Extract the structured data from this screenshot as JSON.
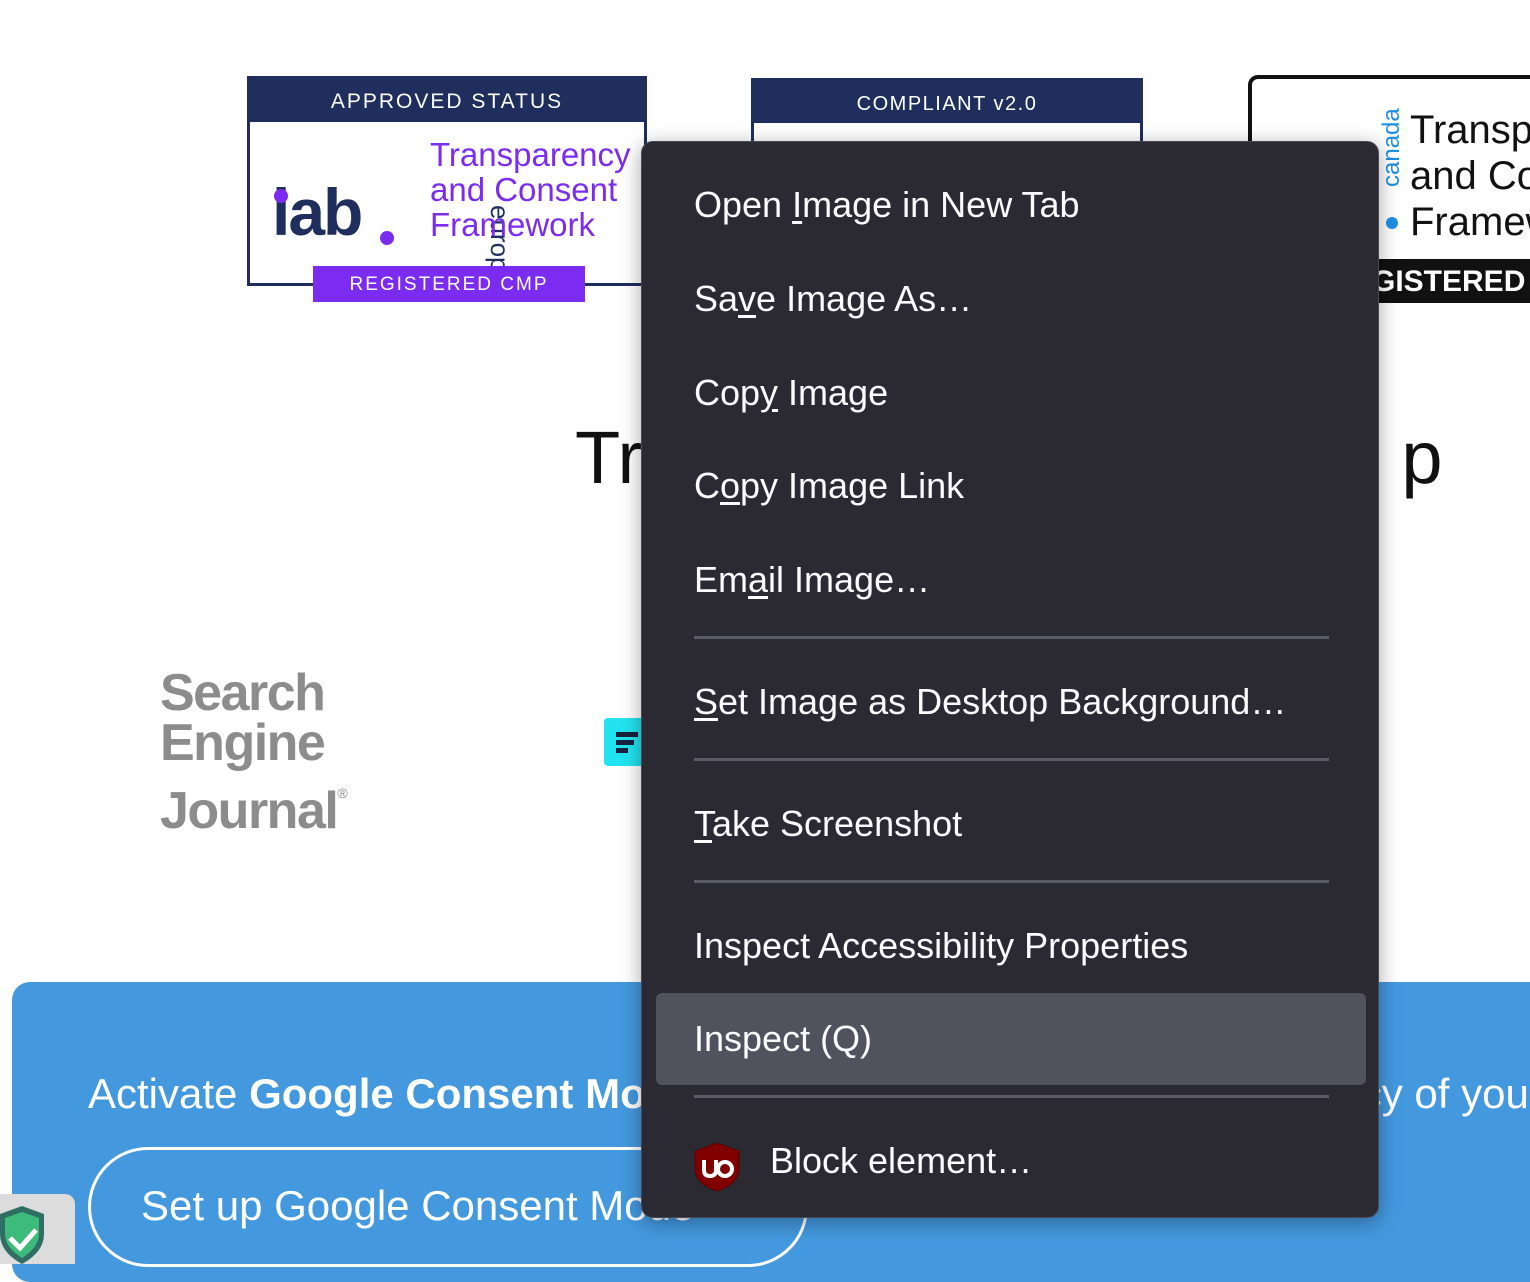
{
  "badges": {
    "iab_europe": {
      "header": "APPROVED STATUS",
      "logo": "iab",
      "region": "europe",
      "title_lines": [
        "Transparency",
        "and Consent",
        "Framework"
      ],
      "footer": "REGISTERED CMP"
    },
    "compliant": {
      "header": "COMPLIANT v2.0"
    },
    "iab_canada": {
      "region": "canada",
      "title_lines": [
        "Transpa",
        "and Cor",
        "Framew"
      ],
      "footer": "GISTERED CM"
    }
  },
  "heading": {
    "left": "Tr",
    "right": "bal p"
  },
  "sej_logo": {
    "lines": [
      "Search",
      "Engine",
      "Journal"
    ],
    "mark": "®"
  },
  "banner": {
    "text_prefix": "Activate ",
    "text_bold": "Google Consent Mo",
    "text_suffix": "cy of you",
    "button_label": "Set up Google Consent Mode"
  },
  "context_menu": {
    "items": [
      {
        "label": "Open Image in New Tab",
        "accel_index": 5
      },
      {
        "label": "Save Image As…",
        "accel_index": 2
      },
      {
        "label": "Copy Image",
        "accel_index": 3
      },
      {
        "label": "Copy Image Link",
        "accel_index": 1
      },
      {
        "label": "Email Image…",
        "accel_index": 2
      },
      {
        "label": "Set Image as Desktop Background…",
        "accel_index": 0
      },
      {
        "label": "Take Screenshot",
        "accel_index": 0
      },
      {
        "label": "Inspect Accessibility Properties",
        "accel_index": -1
      },
      {
        "label": "Inspect (Q)",
        "accel_index": -1,
        "highlighted": true
      },
      {
        "label": "Block element…",
        "accel_index": -1,
        "icon": "ublock-origin-icon"
      }
    ]
  },
  "colors": {
    "menu_bg": "#2b2a33",
    "menu_hover": "#52525e",
    "banner_blue": "#4398de",
    "iab_navy": "#1f2e5c",
    "iab_purple": "#7b2cf0",
    "canada_blue": "#1d8fe5"
  }
}
